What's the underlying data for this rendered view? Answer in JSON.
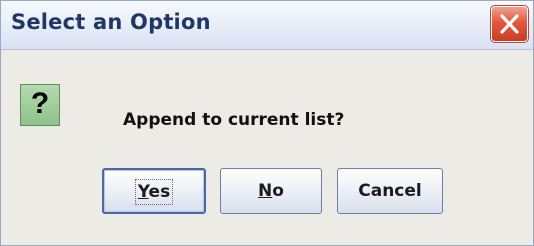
{
  "window": {
    "title": "Select an Option",
    "close_icon": "close-icon"
  },
  "dialog": {
    "icon": "question-icon",
    "icon_glyph": "?",
    "message": "Append to current list?"
  },
  "buttons": {
    "yes": {
      "mnemonic": "Y",
      "rest": "es",
      "focused": true
    },
    "no": {
      "mnemonic": "N",
      "rest": "o"
    },
    "cancel": {
      "label": "Cancel"
    }
  },
  "colors": {
    "title_text": "#1f3766",
    "close_button": "#e2583f",
    "question_icon": "#8ec38a"
  }
}
